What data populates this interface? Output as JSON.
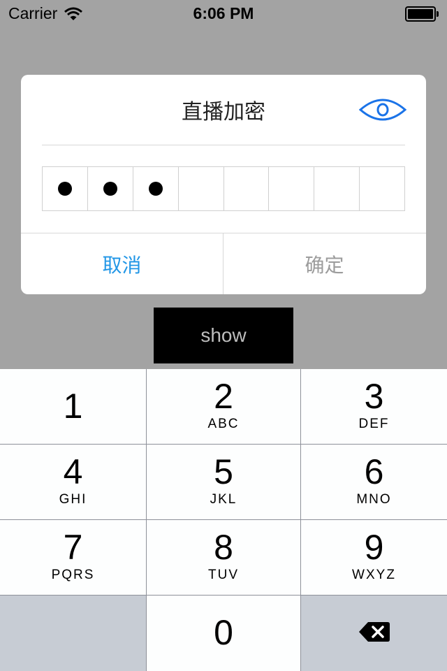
{
  "status_bar": {
    "carrier": "Carrier",
    "time": "6:06 PM"
  },
  "dialog": {
    "title": "直播加密",
    "pin_length": 8,
    "filled_digits": 3,
    "cancel_label": "取消",
    "confirm_label": "确定",
    "accent_color": "#2196e6",
    "icon": "eye-icon"
  },
  "show_button": {
    "label": "show"
  },
  "keypad": {
    "keys": [
      {
        "num": "1",
        "letters": ""
      },
      {
        "num": "2",
        "letters": "ABC"
      },
      {
        "num": "3",
        "letters": "DEF"
      },
      {
        "num": "4",
        "letters": "GHI"
      },
      {
        "num": "5",
        "letters": "JKL"
      },
      {
        "num": "6",
        "letters": "MNO"
      },
      {
        "num": "7",
        "letters": "PQRS"
      },
      {
        "num": "8",
        "letters": "TUV"
      },
      {
        "num": "9",
        "letters": "WXYZ"
      },
      {
        "num": "0",
        "letters": ""
      }
    ],
    "delete_icon": "backspace-icon"
  }
}
